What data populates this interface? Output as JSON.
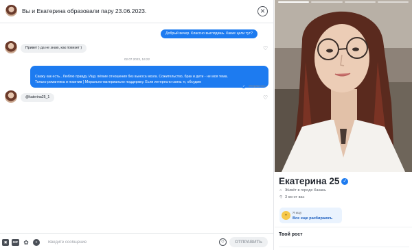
{
  "chat": {
    "header_title": "Вы и Екатерина образовали пару 23.06.2023.",
    "messages": [
      {
        "text": "Добрый вечер. Классно выглядишь. Какие цели тут?"
      },
      {
        "text": "Привет ) да не знаю, как повезет )"
      },
      {
        "text": "Скажу как есть.. Люблю правду. Ищу лёгкие отношения без выноса мозга. Сожительство, брак и дети - не моя тема.\nТолько романтика и позитив ) Морально-материально поддержку. Если интересно скинь тг, обсудим"
      },
      {
        "text": "@katerina25_1"
      }
    ],
    "date_separator": "02.07.2023, 16:22",
    "status_text": "Отправлено",
    "composer": {
      "gif_label": "GIF",
      "placeholder": "Введите сообщение",
      "send_label": "ОТПРАВИТЬ"
    }
  },
  "profile": {
    "name_age": "Екатерина 25",
    "city": "Живёт в городе Казань",
    "distance": "3 км от вас",
    "looking_for": {
      "caption": "Я ищу",
      "value": "Все еще разбираюсь"
    },
    "height_title": "Твой рост"
  },
  "colors": {
    "accent": "#1d7bf0",
    "bubble_in": "#eef0f2"
  },
  "icons": {
    "close": "close-circle-icon",
    "like": "heart-icon",
    "verified": "verified-badge-icon",
    "home": "home-icon",
    "location": "location-pin-icon"
  }
}
